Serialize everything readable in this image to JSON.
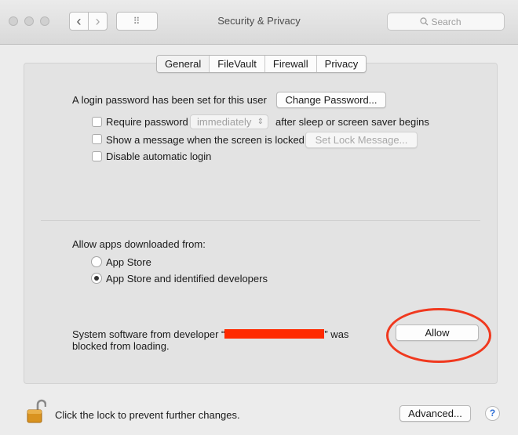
{
  "window": {
    "title": "Security & Privacy",
    "search_placeholder": "Search",
    "back_glyph": "‹",
    "forward_glyph": "›",
    "grid_glyph": "⠿"
  },
  "tabs": [
    {
      "label": "General",
      "selected": true
    },
    {
      "label": "FileVault",
      "selected": false
    },
    {
      "label": "Firewall",
      "selected": false
    },
    {
      "label": "Privacy",
      "selected": false
    }
  ],
  "general": {
    "login_text": "A login password has been set for this user",
    "change_password_label": "Change Password...",
    "require_password": {
      "label": "Require password",
      "select_value": "immediately",
      "suffix": "after sleep or screen saver begins",
      "checked": false
    },
    "show_message": {
      "label": "Show a message when the screen is locked",
      "button_label": "Set Lock Message...",
      "checked": false
    },
    "disable_login": {
      "label": "Disable automatic login",
      "checked": false
    }
  },
  "downloads": {
    "heading": "Allow apps downloaded from:",
    "options": [
      {
        "label": "App Store",
        "selected": false
      },
      {
        "label": "App Store and identified developers",
        "selected": true
      }
    ]
  },
  "blocked": {
    "text_before": "System software from developer “",
    "text_after": "” was",
    "text_line2": "blocked from loading.",
    "allow_label": "Allow",
    "redaction_color": "#ff2a00",
    "annotation_color": "#f0391f"
  },
  "footer": {
    "lock_text": "Click the lock to prevent further changes.",
    "advanced_label": "Advanced...",
    "help_label": "?"
  }
}
